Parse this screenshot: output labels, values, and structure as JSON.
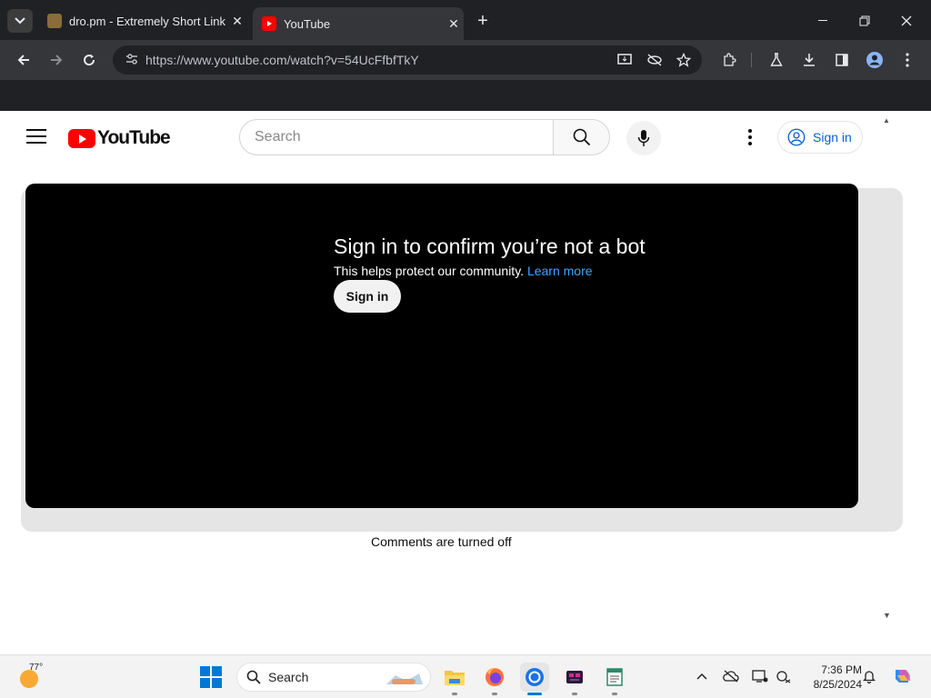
{
  "browser": {
    "tabs": [
      {
        "title": "dro.pm - Extremely Short Link",
        "active": false
      },
      {
        "title": "YouTube",
        "active": true
      }
    ],
    "url": "https://www.youtube.com/watch?v=54UcFfbfTkY",
    "window_controls": [
      "minimize-icon",
      "restore-icon",
      "close-icon"
    ]
  },
  "youtube": {
    "logo_text": "YouTube",
    "search_placeholder": "Search",
    "sign_in_label": "Sign in",
    "player": {
      "title": "Sign in to confirm you’re not a bot",
      "subtitle": "This helps protect our community.",
      "learn_more": "Learn more",
      "button": "Sign in"
    },
    "comments_status": "Comments are turned off",
    "colors": {
      "brand_red": "#ff0000",
      "link_blue": "#065fd4",
      "player_link": "#3ea6ff"
    }
  },
  "taskbar": {
    "weather_temp": "77°",
    "search_label": "Search",
    "time": "7:36 PM",
    "date": "8/25/2024",
    "apps": [
      "file-explorer-icon",
      "firefox-icon",
      "chrome-icon",
      "app-icon",
      "notepad-icon"
    ]
  }
}
